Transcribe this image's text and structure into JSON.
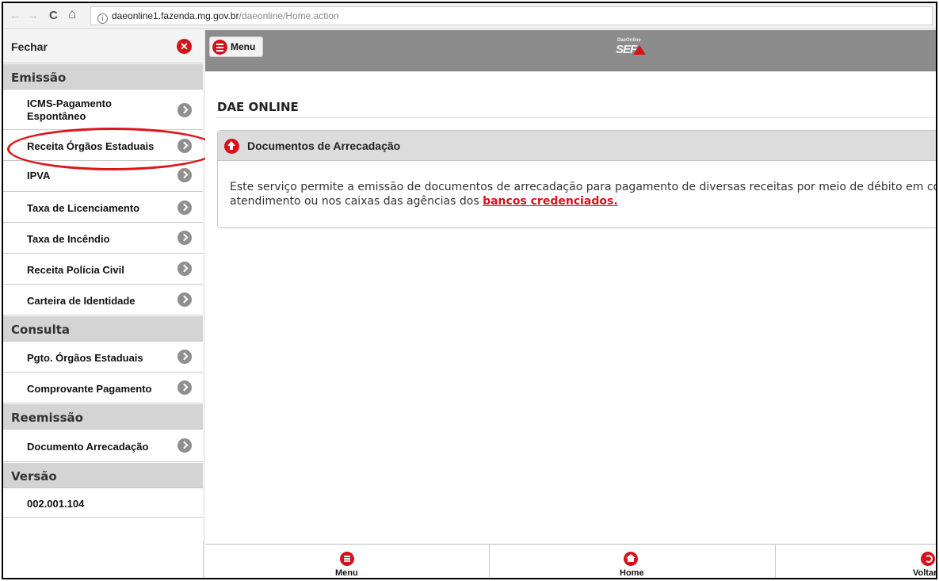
{
  "browser": {
    "back": "←",
    "forward": "→",
    "reload": "C",
    "home": "⌂",
    "info_glyph": "i",
    "url_host": "daeonline1.fazenda.mg.gov.br",
    "url_path": "/daeonline/Home.action"
  },
  "sidebar": {
    "close_label": "Fechar",
    "close_glyph": "✕",
    "sections": [
      {
        "header": "Emissão"
      },
      {
        "header": "Consulta"
      },
      {
        "header": "Reemissão"
      },
      {
        "header": "Versão"
      }
    ],
    "items": [
      {
        "label": "ICMS-Pagamento Espontâneo"
      },
      {
        "label": "Receita Órgãos Estaduais"
      },
      {
        "label": "IPVA"
      },
      {
        "label": "Taxa de Licenciamento"
      },
      {
        "label": "Taxa de Incêndio"
      },
      {
        "label": "Receita Polícia Civil"
      },
      {
        "label": "Carteira de Identidade"
      },
      {
        "label": "Pgto. Órgãos Estaduais"
      },
      {
        "label": "Comprovante Pagamento"
      },
      {
        "label": "Documento Arrecadação"
      }
    ],
    "version": "002.001.104"
  },
  "header": {
    "menu_label": "Menu",
    "logo_small": "DaeOnline",
    "logo_text": "SEF"
  },
  "main": {
    "title": "DAE ONLINE",
    "panel_title": "Documentos de Arrecadação",
    "panel_text": "Este serviço permite a emissão de documentos de arrecadação para pagamento de diversas receitas por meio de débito em conta, auto-atendimento ou nos caixas das agências dos ",
    "panel_link": "bancos credenciados."
  },
  "bottom": {
    "menu_label": "Menu",
    "home_label": "Home",
    "back_label": "Voltar"
  },
  "colors": {
    "accent_red": "#d5121a",
    "header_gray": "#8c8c8c",
    "section_gray": "#d4d4d4",
    "chevron_gray": "#8f8f8f"
  },
  "icons": [
    "close-icon",
    "chevron-right-icon",
    "menu-icon",
    "arrow-up-icon",
    "home-icon",
    "back-icon",
    "info-icon"
  ]
}
